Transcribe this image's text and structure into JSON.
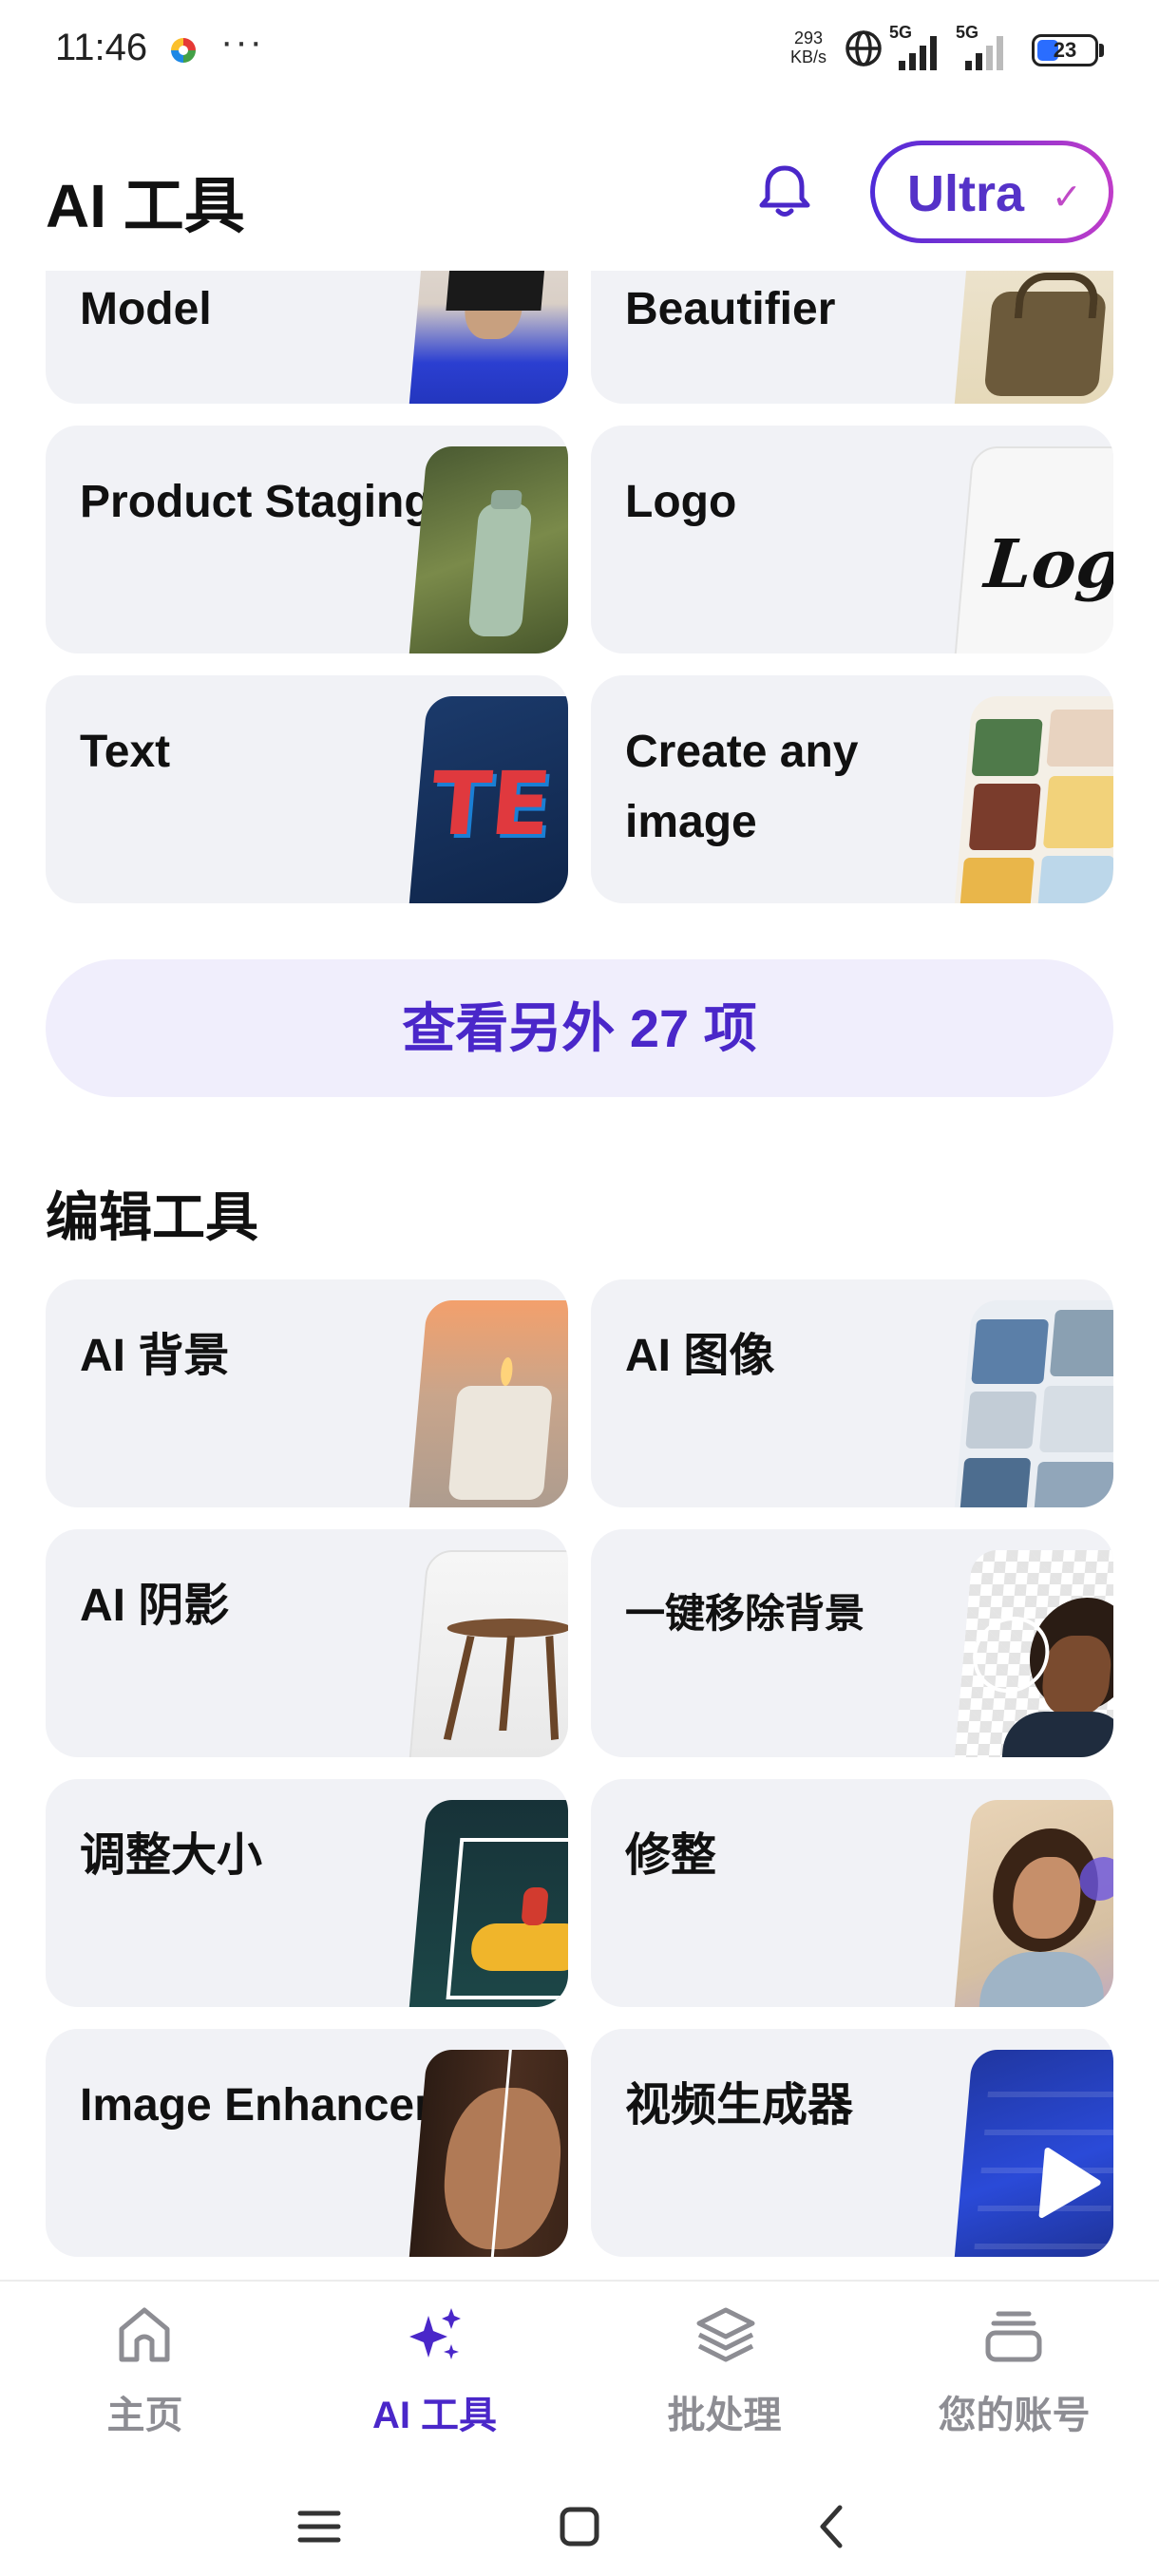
{
  "status_bar": {
    "time": "11:46",
    "more": "···",
    "speed_value": "293",
    "speed_unit": "KB/s",
    "network1": "5G",
    "network2": "5G",
    "battery": "23"
  },
  "header": {
    "title": "AI 工具",
    "bell_icon": "bell-icon",
    "ultra_label": "Ultra",
    "ultra_check": "✓"
  },
  "ai_tools": [
    {
      "label": "Model"
    },
    {
      "label": "Beautifier"
    },
    {
      "label": "Product Staging"
    },
    {
      "label": "Logo"
    },
    {
      "label": "Text"
    },
    {
      "label": "Create any image"
    }
  ],
  "see_more_label": "查看另外 27 项",
  "edit_section_title": "编辑工具",
  "edit_tools": [
    {
      "label": "AI 背景"
    },
    {
      "label": "AI 图像"
    },
    {
      "label": "AI 阴影"
    },
    {
      "label": "一键移除背景"
    },
    {
      "label": "调整大小"
    },
    {
      "label": "修整"
    },
    {
      "label": "Image Enhancer"
    },
    {
      "label": "视频生成器"
    }
  ],
  "bottom_nav": [
    {
      "label": "主页",
      "icon": "home-icon",
      "active": false
    },
    {
      "label": "AI 工具",
      "icon": "sparkles-icon",
      "active": true
    },
    {
      "label": "批处理",
      "icon": "layers-icon",
      "active": false
    },
    {
      "label": "您的账号",
      "icon": "account-stack-icon",
      "active": false
    }
  ],
  "colors": {
    "accent": "#4a27c9",
    "card_bg": "#f1f2f6",
    "see_more_bg": "#f0eefc",
    "inactive_nav": "#8d8d93"
  }
}
